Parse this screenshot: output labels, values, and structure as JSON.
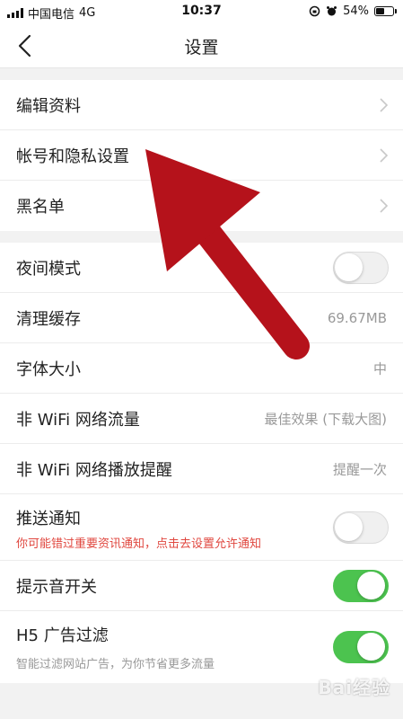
{
  "status_bar": {
    "carrier": "中国电信",
    "network": "4G",
    "time": "10:37",
    "battery_percent": "54%",
    "battery_level": 0.54
  },
  "nav": {
    "title": "设置",
    "back_icon": "chevron-left-icon"
  },
  "group1": [
    {
      "label": "编辑资料"
    },
    {
      "label": "帐号和隐私设置"
    },
    {
      "label": "黑名单"
    }
  ],
  "group2": {
    "night_mode": {
      "label": "夜间模式",
      "on": false
    },
    "clear_cache": {
      "label": "清理缓存",
      "value": "69.67MB"
    },
    "font_size": {
      "label": "字体大小",
      "value": "中"
    },
    "non_wifi_traffic": {
      "label": "非 WiFi 网络流量",
      "value": "最佳效果 (下载大图)"
    },
    "non_wifi_play": {
      "label": "非 WiFi 网络播放提醒",
      "value": "提醒一次"
    },
    "push": {
      "label": "推送通知",
      "sub": "你可能错过重要资讯通知，点击去设置允许通知",
      "on": false
    },
    "sound": {
      "label": "提示音开关",
      "on": true
    },
    "ad_filter": {
      "label": "H5 广告过滤",
      "sub": "智能过滤网站广告，为你节省更多流量",
      "on": true
    }
  },
  "colors": {
    "toggle_on": "#4cc34f",
    "warning_text": "#e0473f",
    "arrow_annotation": "#b5121b"
  },
  "watermark": "Bai经验"
}
